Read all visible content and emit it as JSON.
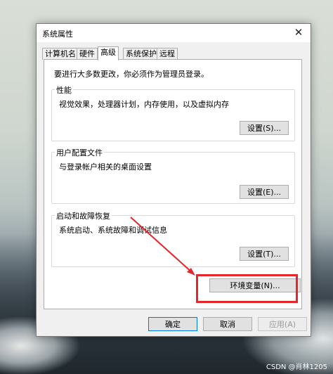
{
  "window": {
    "title": "系统属性",
    "close_symbol": "✕"
  },
  "tabs": [
    {
      "label": "计算机名",
      "active": false
    },
    {
      "label": "硬件",
      "active": false
    },
    {
      "label": "高级",
      "active": true
    },
    {
      "label": "系统保护",
      "active": false
    },
    {
      "label": "远程",
      "active": false
    }
  ],
  "intro_text": "要进行大多数更改，你必须作为管理员登录。",
  "performance": {
    "label": "性能",
    "description": "视觉效果，处理器计划，内存使用，以及虚拟内存",
    "button": "设置(S)..."
  },
  "user_profiles": {
    "label": "用户配置文件",
    "description": "与登录帐户相关的桌面设置",
    "button": "设置(E)..."
  },
  "startup_recovery": {
    "label": "启动和故障恢复",
    "description": "系统启动、系统故障和调试信息",
    "button": "设置(T)..."
  },
  "env_button": "环境变量(N)...",
  "footer": {
    "ok": "确定",
    "cancel": "取消",
    "apply": "应用(A)"
  },
  "watermark": "CSDN @肖林1205",
  "colors": {
    "annotation": "#e5262a",
    "focus_border": "#0078d7"
  }
}
